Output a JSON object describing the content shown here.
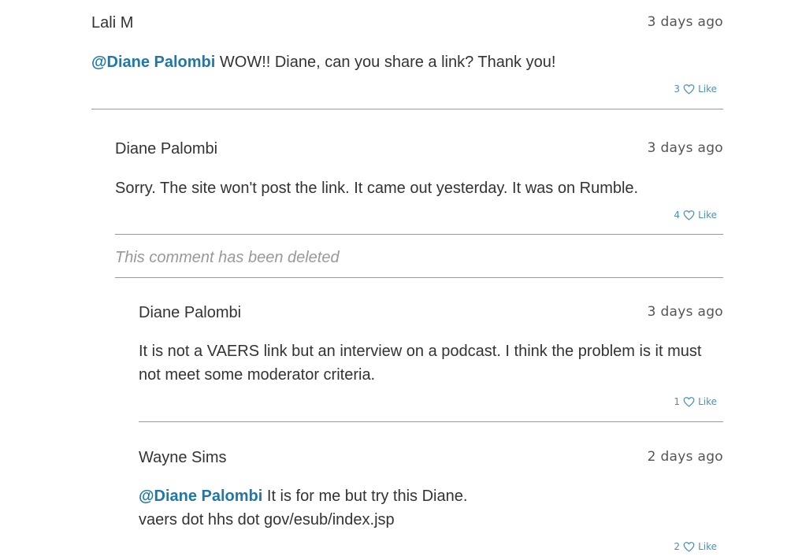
{
  "comments": [
    {
      "author": "Lali M",
      "time": "3 days ago",
      "mention": "@Diane Palombi",
      "text": " WOW!!  Diane, can  you share a link?  Thank you!",
      "like_count": "3",
      "like_label": "Like"
    },
    {
      "author": "Diane Palombi",
      "time": "3 days ago",
      "text": "Sorry. The site won't post the link. It came out yesterday. It was on Rumble.",
      "like_count": "4",
      "like_label": "Like"
    },
    {
      "author": "Diane Palombi",
      "time": "3 days ago",
      "text_line1": "It is not a VAERS link but an interview on a podcast. I think the problem is it must",
      "text_line2": "not meet some moderator criteria.",
      "like_count": "1",
      "like_label": "Like"
    },
    {
      "author": "Wayne Sims",
      "time": "2 days ago",
      "mention": "@Diane Palombi",
      "text_line1": " It is for me but try this Diane.",
      "text_line2": "vaers dot hhs dot gov/esub/index.jsp",
      "like_count": "2",
      "like_label": "Like"
    }
  ],
  "deleted_text": "This comment has been deleted",
  "colors": {
    "mention": "#1f78a8",
    "like": "#4a90b8",
    "divider": "#999999"
  },
  "icons": {
    "like": "heart-outline-icon"
  }
}
